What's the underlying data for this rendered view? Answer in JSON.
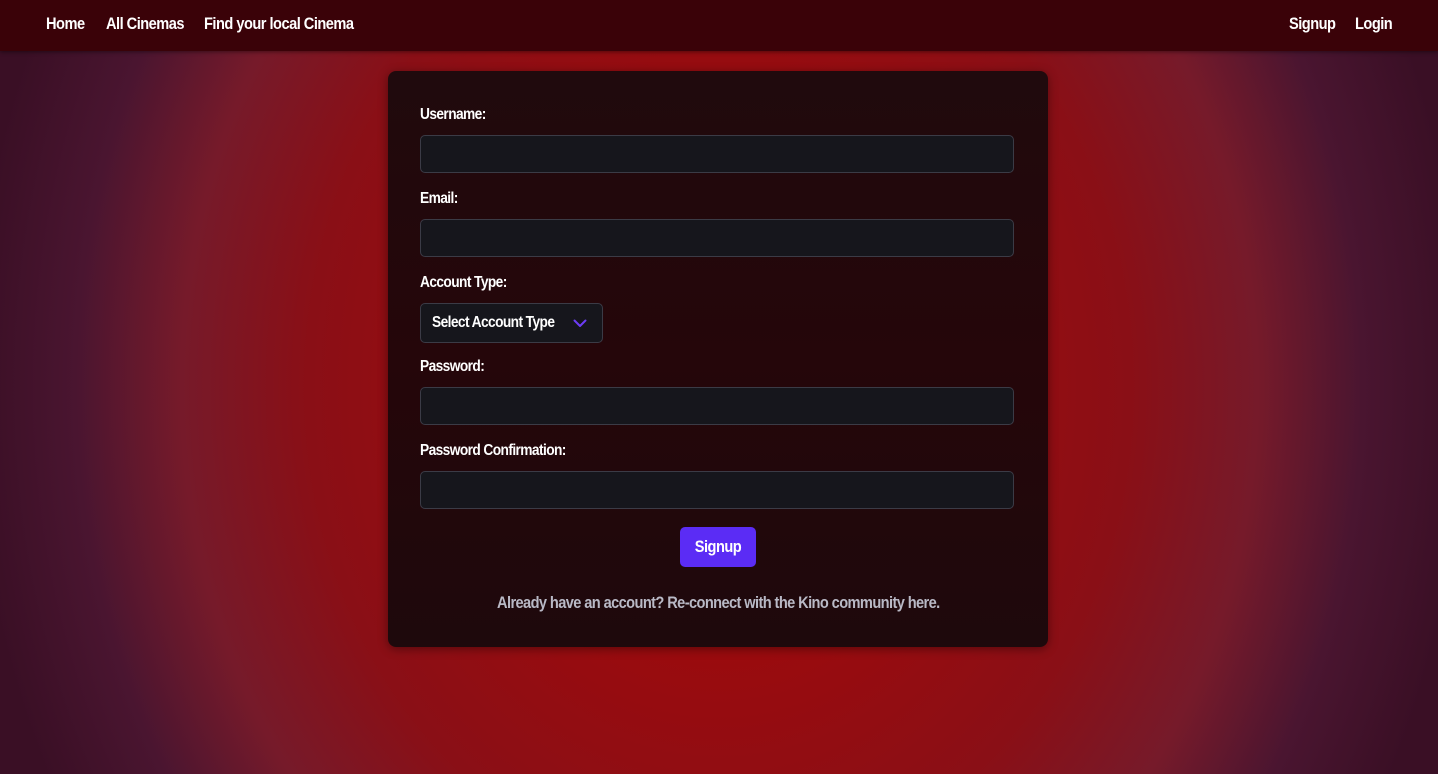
{
  "nav": {
    "home": "Home",
    "all_cinemas": "All Cinemas",
    "find_cinema": "Find your local Cinema",
    "signup": "Signup",
    "login": "Login"
  },
  "form": {
    "username_label": "Username:",
    "username_value": "",
    "email_label": "Email:",
    "email_value": "",
    "account_type_label": "Account Type:",
    "account_type_selected": "Select Account Type",
    "password_label": "Password:",
    "password_value": "",
    "password_confirmation_label": "Password Confirmation:",
    "password_confirmation_value": "",
    "submit_label": "Signup",
    "footer_text": "Already have an account? Re-connect with the Kino community here."
  },
  "icons": {
    "select_chevron": "chevron-down-icon"
  },
  "colors": {
    "navbar": "#3a0208",
    "card": "#22080b",
    "input_background": "#16161c",
    "button": "#5b2cf5",
    "chevron": "#6d3cf5",
    "footer_text": "#b9b9c6"
  }
}
